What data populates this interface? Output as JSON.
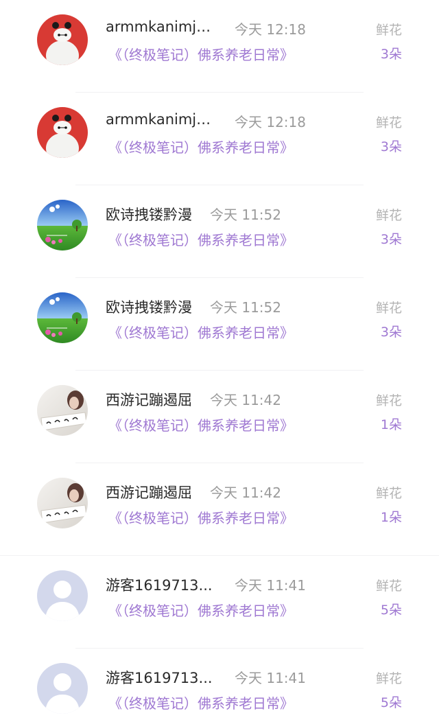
{
  "entries": [
    {
      "name": "armmkanimjb...",
      "time": "今天 12:18",
      "book": "《（终极笔记）佛系养老日常》",
      "gift": "鲜花",
      "count": "3朵",
      "avatar": "baymax-avatar"
    },
    {
      "name": "armmkanimjb...",
      "time": "今天 12:18",
      "book": "《（终极笔记）佛系养老日常》",
      "gift": "鲜花",
      "count": "3朵",
      "avatar": "baymax-avatar"
    },
    {
      "name": "欧诗拽镂黔漫",
      "time": "今天 11:52",
      "book": "《（终极笔记）佛系养老日常》",
      "gift": "鲜花",
      "count": "3朵",
      "avatar": "meadow-avatar"
    },
    {
      "name": "欧诗拽镂黔漫",
      "time": "今天 11:52",
      "book": "《（终极笔记）佛系养老日常》",
      "gift": "鲜花",
      "count": "3朵",
      "avatar": "meadow-avatar"
    },
    {
      "name": "西游记蹦遏屈",
      "time": "今天 11:42",
      "book": "《（终极笔记）佛系养老日常》",
      "gift": "鲜花",
      "count": "1朵",
      "avatar": "calligraphy-avatar"
    },
    {
      "name": "西游记蹦遏屈",
      "time": "今天 11:42",
      "book": "《（终极笔记）佛系养老日常》",
      "gift": "鲜花",
      "count": "1朵",
      "avatar": "calligraphy-avatar"
    },
    {
      "name": "游客1619713...",
      "time": "今天 11:41",
      "book": "《（终极笔记）佛系养老日常》",
      "gift": "鲜花",
      "count": "5朵",
      "avatar": "default-user-avatar"
    },
    {
      "name": "游客1619713...",
      "time": "今天 11:41",
      "book": "《（终极笔记）佛系养老日常》",
      "gift": "鲜花",
      "count": "5朵",
      "avatar": "default-user-avatar"
    }
  ],
  "colors": {
    "accent_purple": "#9f78d2",
    "name_text": "#2a2a2a",
    "muted_text": "#9b9b9b",
    "divider": "#f1f1f3"
  }
}
